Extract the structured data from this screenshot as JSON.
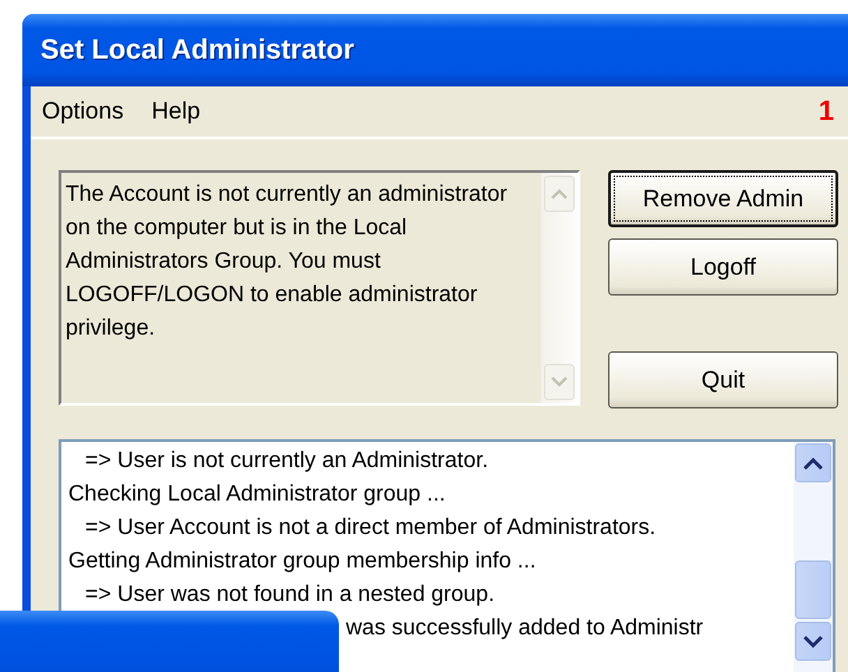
{
  "window": {
    "title": "Set Local Administrator"
  },
  "menu": [
    {
      "label": "Options"
    },
    {
      "label": "Help"
    }
  ],
  "annotation": "1",
  "message": {
    "text": "The Account is not currently an administrator on the computer but is in the Local Administrators Group. You must LOGOFF/LOGON to enable administrator privilege.",
    "disabled": true
  },
  "buttons": [
    {
      "label": "Remove Admin",
      "focused": true
    },
    {
      "label": "Logoff",
      "focused": false
    },
    {
      "label": "Quit",
      "focused": false
    }
  ],
  "log": [
    {
      "text": "=> User is not currently an Administrator.",
      "kind": "indented"
    },
    {
      "text": "Checking Local Administrator group ...",
      "kind": "plain"
    },
    {
      "text": "=> User Account is not a direct member of Administrators.",
      "kind": "indented"
    },
    {
      "text": "Getting Administrator group membership info ...",
      "kind": "plain"
    },
    {
      "text": "=> User was not found in a nested group.",
      "kind": "indented"
    },
    {
      "text": "was successfully added to Administr",
      "kind": "covered"
    }
  ]
}
